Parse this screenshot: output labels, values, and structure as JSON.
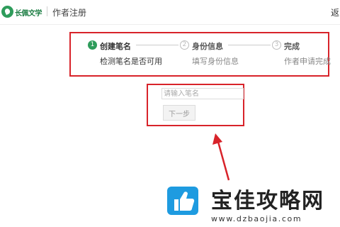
{
  "header": {
    "logo_text": "长佩文学",
    "page_title": "作者注册",
    "back_label": "返"
  },
  "steps": [
    {
      "number": "1",
      "title": "创建笔名",
      "description": "检测笔名是否可用",
      "state": "active"
    },
    {
      "number": "2",
      "title": "身份信息",
      "description": "填写身份信息",
      "state": "pending"
    },
    {
      "number": "3",
      "title": "完成",
      "description": "作者申请完成",
      "state": "pending"
    }
  ],
  "form": {
    "pen_name_placeholder": "请输入笔名",
    "pen_name_value": "",
    "next_label": "下一步"
  },
  "watermark": {
    "title": "宝佳攻略网",
    "url": "www.dzbaojia.com"
  },
  "colors": {
    "brand_green": "#2e9c5b",
    "highlight_red": "#d8232a",
    "watermark_blue": "#1e9be0"
  }
}
